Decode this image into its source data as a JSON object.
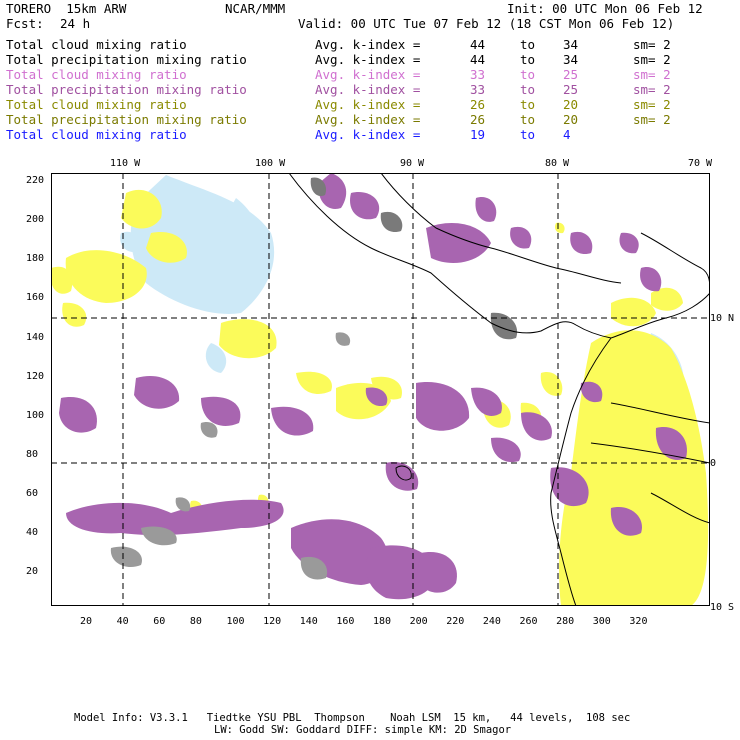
{
  "header": {
    "model": "TORERO  15km ARW",
    "org": "NCAR/MMM",
    "init": "Init: 00 UTC Mon 06 Feb 12",
    "fcst_label": "Fcst:",
    "fcst_value": "24 h",
    "valid": "Valid: 00 UTC Tue 07 Feb 12 (18 CST Mon 06 Feb 12)"
  },
  "legend": [
    {
      "name": "Total cloud mixing ratio",
      "avg": "Avg. k-index =",
      "hi": "44",
      "to": "to",
      "lo": "34",
      "sm": "sm= 2",
      "color": "#000000"
    },
    {
      "name": "Total precipitation mixing ratio",
      "avg": "Avg. k-index =",
      "hi": "44",
      "to": "to",
      "lo": "34",
      "sm": "sm= 2",
      "color": "#000000"
    },
    {
      "name": "Total cloud mixing ratio",
      "avg": "Avg. k-index =",
      "hi": "33",
      "to": "to",
      "lo": "25",
      "sm": "sm= 2",
      "color": "#d070d0"
    },
    {
      "name": "Total precipitation mixing ratio",
      "avg": "Avg. k-index =",
      "hi": "33",
      "to": "to",
      "lo": "25",
      "sm": "sm= 2",
      "color": "#a050a0"
    },
    {
      "name": "Total cloud mixing ratio",
      "avg": "Avg. k-index =",
      "hi": "26",
      "to": "to",
      "lo": "20",
      "sm": "sm= 2",
      "color": "#8a8a00"
    },
    {
      "name": "Total precipitation mixing ratio",
      "avg": "Avg. k-index =",
      "hi": "26",
      "to": "to",
      "lo": "20",
      "sm": "sm= 2",
      "color": "#7a7a00"
    },
    {
      "name": "Total cloud mixing ratio",
      "avg": "Avg. k-index =",
      "hi": "19",
      "to": "to",
      "lo": "4",
      "sm": "",
      "color": "#1a1aff"
    }
  ],
  "map": {
    "x_ticks": [
      "20",
      "40",
      "60",
      "80",
      "100",
      "120",
      "140",
      "160",
      "180",
      "200",
      "220",
      "240",
      "260",
      "280",
      "300",
      "320"
    ],
    "y_ticks": [
      "220",
      "200",
      "180",
      "160",
      "140",
      "120",
      "100",
      "80",
      "60",
      "40",
      "20"
    ],
    "lon_labels": [
      "110 W",
      "100 W",
      "90 W",
      "80 W",
      "70 W"
    ],
    "lat_labels": [
      "10 N",
      "0",
      "10 S"
    ],
    "colors": {
      "gray": "#9a9a9a",
      "dark_gray": "#7a7a7a",
      "purple": "#a865b0",
      "yellow": "#fbfb5a",
      "light_blue": "#cde9f7",
      "coast": "#000000",
      "grid": "#000000"
    }
  },
  "footer": {
    "line1": "Model Info: V3.3.1   Tiedtke YSU PBL  Thompson    Noah LSM  15 km,   44 levels,  108 sec",
    "line2": "LW: Godd SW: Goddard DIFF: simple KM: 2D Smagor"
  }
}
